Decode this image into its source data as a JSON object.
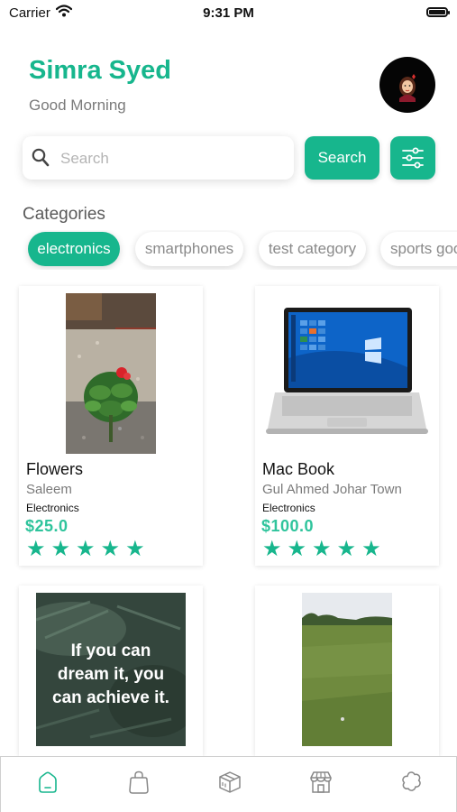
{
  "status_bar": {
    "carrier": "Carrier",
    "time": "9:31 PM"
  },
  "header": {
    "user_name": "Simra Syed",
    "greeting": "Good Morning"
  },
  "search": {
    "placeholder": "Search",
    "value": "",
    "button_label": "Search"
  },
  "categories": {
    "title": "Categories",
    "items": [
      {
        "label": "electronics",
        "active": true
      },
      {
        "label": "smartphones",
        "active": false
      },
      {
        "label": "test category",
        "active": false
      },
      {
        "label": "sports goods",
        "active": false
      }
    ]
  },
  "products": [
    {
      "name": "Flowers",
      "seller": "Saleem",
      "category": "Electronics",
      "price": "$25.0",
      "rating": 5
    },
    {
      "name": "Mac Book",
      "seller": "Gul Ahmed Johar Town",
      "category": "Electronics",
      "price": "$100.0",
      "rating": 5
    },
    {
      "image_text": "If you can dream it, you can achieve it."
    },
    {}
  ],
  "tabs": [
    {
      "icon": "home-icon",
      "active": true
    },
    {
      "icon": "bag-icon",
      "active": false
    },
    {
      "icon": "package-icon",
      "active": false
    },
    {
      "icon": "store-icon",
      "active": false
    },
    {
      "icon": "settings-icon",
      "active": false
    }
  ],
  "colors": {
    "accent": "#17b68d",
    "price": "#2fc49c",
    "muted_text": "#7a7a7a"
  }
}
